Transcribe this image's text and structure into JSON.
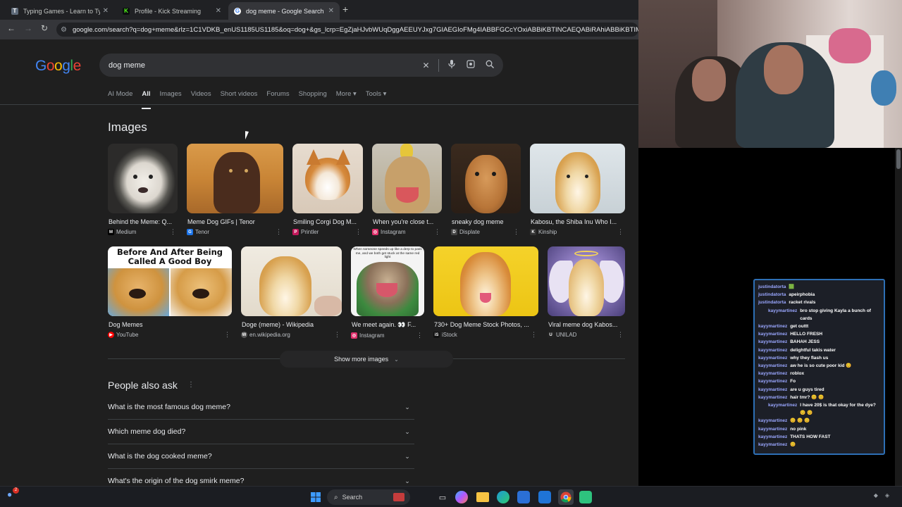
{
  "browser": {
    "tabs": [
      {
        "title": "Typing Games - Learn to Type ...",
        "favicon": "square-icon",
        "color": "#5f6b7a",
        "active": false
      },
      {
        "title": "Profile - Kick Streaming",
        "favicon": "kick-icon",
        "color": "#53fc18",
        "active": false
      },
      {
        "title": "dog meme - Google Search",
        "favicon": "google-icon",
        "color": "#ffffff",
        "active": true
      }
    ],
    "new_tab": "+",
    "url": "google.com/search?q=dog+meme&rlz=1C1VDKB_enUS1185US1185&oq=dog+&gs_lcrp=EgZjaHJvbWUqDggAEEUYJxg7GIAEGIoFMg4IABBFGCcYOxiABBiKBTINCAEQABiRAhiABBiKBTIMCAIQABhD"
  },
  "google": {
    "logo": [
      "G",
      "o",
      "o",
      "g",
      "l",
      "e"
    ],
    "query": "dog meme",
    "tabs": [
      "AI Mode",
      "All",
      "Images",
      "Videos",
      "Short videos",
      "Forums",
      "Shopping",
      "More",
      "Tools"
    ],
    "active_tab": "All",
    "images_heading": "Images",
    "row1": [
      {
        "caption": "Behind the Meme: Q...",
        "source": "Medium",
        "icon": "M",
        "icon_color": "#000000"
      },
      {
        "caption": "Meme Dog GIFs | Tenor",
        "source": "Tenor",
        "icon": "G",
        "icon_color": "#1a73e8"
      },
      {
        "caption": "Smiling Corgi Dog M...",
        "source": "Printler",
        "icon": "P",
        "icon_color": "#c2185b"
      },
      {
        "caption": "When you're close t...",
        "source": "Instagram",
        "icon": "◎",
        "icon_color": "#e1306c"
      },
      {
        "caption": "sneaky dog meme",
        "source": "Displate",
        "icon": "D",
        "icon_color": "#444444"
      },
      {
        "caption": "Kabosu, the Shiba Inu Who I...",
        "source": "Kinship",
        "icon": "K",
        "icon_color": "#333333"
      }
    ],
    "row2": [
      {
        "caption": "Dog Memes",
        "source": "YouTube",
        "icon": "▶",
        "icon_color": "#ff0000",
        "thumb_text": "Before And After Being Called A Good Boy"
      },
      {
        "caption": "Doge (meme) - Wikipedia",
        "source": "en.wikipedia.org",
        "icon": "W",
        "icon_color": "#555555"
      },
      {
        "caption": "We meet again. 👀 F...",
        "source": "Instagram",
        "icon": "◎",
        "icon_color": "#e1306c",
        "thumb_text": "When someone speeds up like a derp to pass me, and we both get stuck at the same red light"
      },
      {
        "caption": "730+ Dog Meme Stock Photos, ...",
        "source": "iStock",
        "icon": "iS",
        "icon_color": "#111111"
      },
      {
        "caption": "Viral meme dog Kabos...",
        "source": "UNILAD",
        "icon": "U",
        "icon_color": "#222222"
      }
    ],
    "show_more": "Show more images",
    "paa_title": "People also ask",
    "questions": [
      "What is the most famous dog meme?",
      "Which meme dog died?",
      "What is the dog cooked meme?",
      "What's the origin of the dog smirk meme?"
    ]
  },
  "chat": [
    {
      "user": "justindatorta",
      "msg": "🟩",
      "indent": false
    },
    {
      "user": "justindatorta",
      "msg": "apeirphobia",
      "indent": false
    },
    {
      "user": "justindatorta",
      "msg": "racket rivals",
      "indent": false
    },
    {
      "user": "kayymartinez",
      "msg": "bro stop giving Kayla a bunch of cards",
      "indent": true
    },
    {
      "user": "kayymartinez",
      "msg": "get outtt",
      "indent": false
    },
    {
      "user": "kayymartinez",
      "msg": "HELLO FRESH",
      "indent": false
    },
    {
      "user": "kayymartinez",
      "msg": "BAHAH JESS",
      "indent": false
    },
    {
      "user": "kayymartinez",
      "msg": "delightful takis water",
      "indent": false
    },
    {
      "user": "kayymartinez",
      "msg": "why they flash us",
      "indent": false
    },
    {
      "user": "kayymartinez",
      "msg": "aw he is so cute poor kid 😊",
      "indent": false
    },
    {
      "user": "kayymartinez",
      "msg": "roblox",
      "indent": false
    },
    {
      "user": "kayymartinez",
      "msg": "Fo",
      "indent": false
    },
    {
      "user": "kayymartinez",
      "msg": "are u guys tired",
      "indent": false
    },
    {
      "user": "kayymartinez",
      "msg": "hair tmr? 😊 😊",
      "indent": false
    },
    {
      "user": "kayymartinez",
      "msg": "I have 20$ is that okay for the dye? 😊 😊",
      "indent": true
    },
    {
      "user": "kayymartinez",
      "msg": "😊 😊 😊",
      "indent": false
    },
    {
      "user": "kayymartinez",
      "msg": "no pink",
      "indent": false
    },
    {
      "user": "kayymartinez",
      "msg": "THATS HOW FAST",
      "indent": false
    },
    {
      "user": "kayymartinez",
      "msg": "😊",
      "indent": false
    }
  ],
  "taskbar": {
    "search": "Search",
    "notification_count": "2",
    "apps": [
      "windows-start-icon",
      "calendar-icon",
      "task-view-icon",
      "copilot-icon",
      "file-explorer-icon",
      "edge-icon",
      "store-icon",
      "outlook-icon",
      "chrome-icon",
      "app-icon"
    ]
  }
}
